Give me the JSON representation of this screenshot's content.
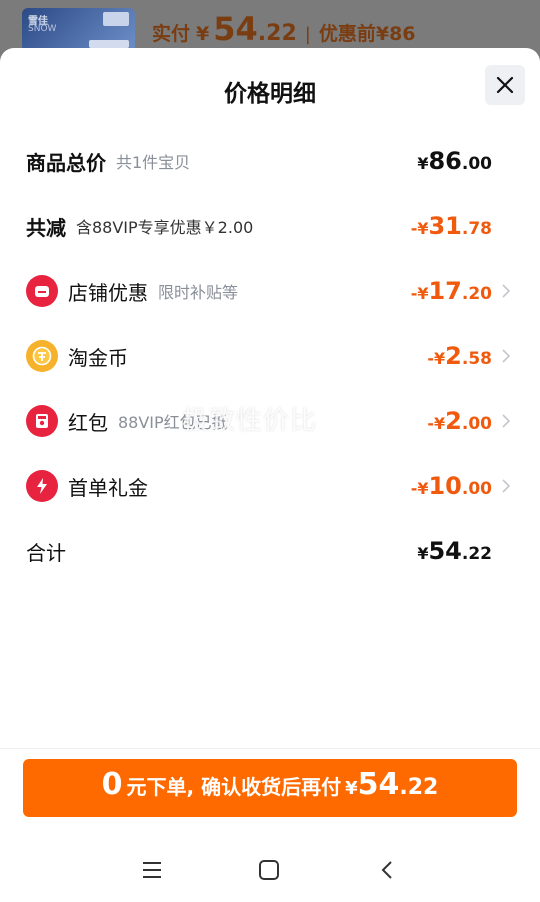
{
  "background": {
    "thumbnail": {
      "line1": "雪佳",
      "line2": "SNOW",
      "tag": "直购"
    },
    "price_label": "实付",
    "currency": "¥",
    "price_int": "54",
    "price_dec": ".22",
    "separator": "|",
    "original_price": "优惠前¥86"
  },
  "sheet": {
    "title": "价格明细",
    "close_icon": "close-icon"
  },
  "rows": {
    "total": {
      "name": "商品总价",
      "sub": "共1件宝贝",
      "sign": "¥",
      "int": "86",
      "dec": ".00"
    },
    "reduce": {
      "name": "共减",
      "sub": "含88VIP专享优惠￥2.00",
      "sign": "-¥",
      "int": "31",
      "dec": ".78"
    },
    "store": {
      "name": "店铺优惠",
      "sub": "限时补贴等",
      "sign": "-¥",
      "int": "17",
      "dec": ".20",
      "icon": "store-icon"
    },
    "coin": {
      "name": "淘金币",
      "sub": "",
      "sign": "-¥",
      "int": "2",
      "dec": ".58",
      "icon": "coin-icon"
    },
    "redpacket": {
      "name": "红包",
      "sub": "88VIP红包已抵",
      "sign": "-¥",
      "int": "2",
      "dec": ".00",
      "icon": "red-packet-icon"
    },
    "firstorder": {
      "name": "首单礼金",
      "sub": "",
      "sign": "-¥",
      "int": "10",
      "dec": ".00",
      "icon": "lightning-icon"
    },
    "sum": {
      "name": "合计",
      "sign": "¥",
      "int": "54",
      "dec": ".22"
    }
  },
  "watermark": "极致性价比",
  "cta": {
    "n0": "0",
    "text": "元下单, 确认收货后再付",
    "yen": "¥",
    "int": "54",
    "dec": ".22"
  },
  "navbar": {
    "menu": "menu-icon",
    "home": "home-icon",
    "back": "back-icon"
  },
  "colors": {
    "accent": "#ff6a00",
    "discount": "#f05a0e",
    "icon_red": "#e8233f",
    "coin": "#f7b22b"
  }
}
